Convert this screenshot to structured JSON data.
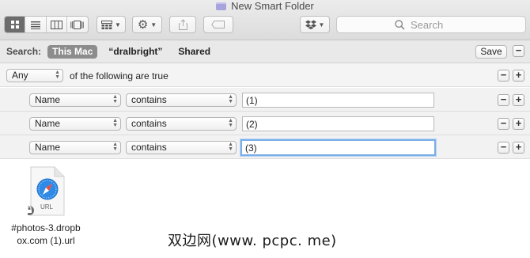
{
  "window": {
    "title": "New Smart Folder"
  },
  "toolbar": {
    "view_modes": [
      "icon-view",
      "list-view",
      "column-view",
      "cover-flow-view"
    ],
    "active_view": "icon-view",
    "search_placeholder": "Search"
  },
  "scope": {
    "label": "Search:",
    "options": [
      "This Mac",
      "“dralbright”",
      "Shared"
    ],
    "active": "This Mac",
    "save_label": "Save"
  },
  "criteria": {
    "match_mode": "Any",
    "match_suffix": "of the following are true",
    "rules": [
      {
        "attribute": "Name",
        "operator": "contains",
        "value": "(1)"
      },
      {
        "attribute": "Name",
        "operator": "contains",
        "value": "(2)"
      },
      {
        "attribute": "Name",
        "operator": "contains",
        "value": "(3)"
      }
    ]
  },
  "results": {
    "files": [
      {
        "name_line1": "#photos-3.dropb",
        "name_line2": "ox.com (1).url",
        "icon_badge": "URL"
      }
    ]
  },
  "watermark": "双边网(www. pcpc. me)",
  "colors": {
    "focus_ring": "#7aaee8",
    "active_segment": "#6c6c6c",
    "scope_active": "#8c8c8c"
  }
}
